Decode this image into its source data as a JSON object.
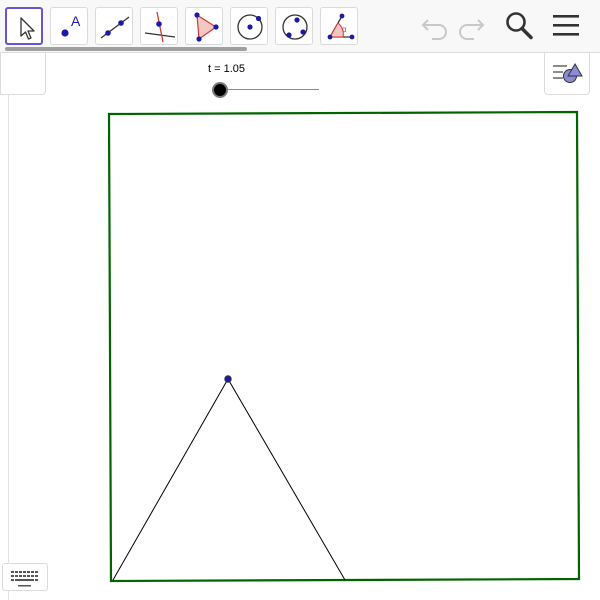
{
  "toolbar": {
    "tools": [
      {
        "name": "move-tool",
        "icon": "cursor-arrow-icon",
        "selected": true
      },
      {
        "name": "point-tool",
        "icon": "point-a-icon",
        "label": "A"
      },
      {
        "name": "line-tool",
        "icon": "line-through-points-icon"
      },
      {
        "name": "perpendicular-line-tool",
        "icon": "perpendicular-line-icon"
      },
      {
        "name": "polygon-tool",
        "icon": "polygon-icon"
      },
      {
        "name": "circle-center-point-tool",
        "icon": "circle-center-point-icon"
      },
      {
        "name": "circle-three-points-tool",
        "icon": "circle-three-points-icon"
      },
      {
        "name": "angle-tool",
        "icon": "angle-icon",
        "label": "α"
      }
    ],
    "actions": [
      {
        "name": "undo-button",
        "icon": "undo-icon",
        "enabled": false
      },
      {
        "name": "redo-button",
        "icon": "redo-icon",
        "enabled": false
      },
      {
        "name": "search-button",
        "icon": "search-icon"
      },
      {
        "name": "menu-button",
        "icon": "hamburger-menu-icon"
      }
    ]
  },
  "slider": {
    "label": "t = 1.05",
    "value": 1.05
  },
  "colors": {
    "accent": "#6557d2",
    "square_border": "#006400",
    "point": "#1a1aa6",
    "polygon_fill": "#f4c7c3",
    "icon_dark": "#333333"
  },
  "graphics": {
    "square": {
      "stroke": "#006400"
    },
    "triangle": {
      "apex_point_color": "#1a1aa6"
    }
  },
  "style_bar": {
    "icon": "style-bar-shapes-icon"
  },
  "keyboard": {
    "icon": "keyboard-icon"
  }
}
